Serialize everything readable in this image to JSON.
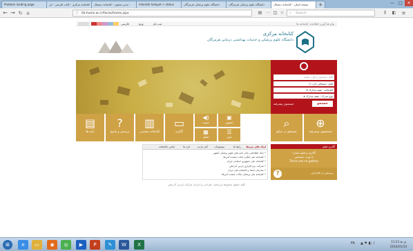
{
  "browser": {
    "tabs": [
      {
        "title": "Problem loading page"
      },
      {
        "title": "کتابخانه مرکزی - کتاب فارسی - ایر"
      },
      {
        "title": "مدیر محتوی - کتابخانه دیجیتال -"
      },
      {
        "title": "mikrotik hotspot > status"
      },
      {
        "title": "دانشگاه علوم پزشکی هرمزگان"
      },
      {
        "title": "دانشگاه علوم پزشکی هرمزگان"
      },
      {
        "title": "صفحه اصلی - کتابخانه دیجیتال"
      }
    ],
    "url": "lib.hums.ac.ir/faces/home.jspx",
    "search_placeholder": "Search",
    "window_controls": [
      "—",
      "□",
      "✕"
    ]
  },
  "site": {
    "topstrip": {
      "left_label": "پیام فنا آوری اطلاعات کتابخانه ها",
      "links": [
        "ثبت نام",
        "ورود",
        "فارسی"
      ]
    },
    "logo": {
      "line1": "کتابخانه مرکزی",
      "line2": "دانشگاه علوم پزشکی و خدمات بهداشتی درمانی هرمزگان"
    },
    "search_panel": {
      "input_placeholder": "کلید جستجو را وارد نمایید",
      "checkbox_label": "فایل دیجیتالی دارد",
      "select1": "همه مدارک",
      "select2": "همه مدارک",
      "select1_label": "کتابخانه",
      "select2_label": "نوع مدرک",
      "advanced_link": "جستجوی پیشرفته",
      "search_button": "جستجو"
    },
    "tiles": [
      {
        "label": "تازه ها",
        "icon": "doc-icon"
      },
      {
        "label": "پرسش و پاسخ",
        "icon": "question-icon"
      },
      {
        "label": "کتابخانه شخصی",
        "icon": "books-icon"
      },
      {
        "label": "گالری",
        "icon": "gallery-icon"
      },
      {
        "label": "صوت",
        "icon": "audio-icon"
      },
      {
        "label": "تصویر",
        "icon": "image-icon"
      },
      {
        "label": "فیلم",
        "icon": "film-icon"
      },
      {
        "label": "متن",
        "icon": "text-icon"
      },
      {
        "label": "جستجو در منابع",
        "icon": "search-icon"
      },
      {
        "label": "جستجوی پیشرفته",
        "icon": "search-plus-icon"
      }
    ],
    "gallery_panel": {
      "title": "گالری فیلم",
      "lines": [
        "گالری و فیلم اشاره",
        "تا نوبت مشخص",
        "There are no gallery"
      ],
      "footer": "پرسش در کتابداری"
    },
    "news": {
      "tabs": [
        "لینک های مرتبط",
        "رابط ها",
        "موضوعات",
        "آمار بازدید",
        "تازه ها",
        "تماس باکتابخانه"
      ],
      "items": [
        "بانک اطلاعاتی پایان نامه های علوم پزشکی کشور",
        "کتابخانه ملی کنگره ایالات متحده آمریکا",
        "کتابخانه ملی جمهوری اسلامی ایران",
        "شرکت نرم افزاری پارس آذرخش",
        "سازمان اسناد و کتابخانه ملی ایران",
        "کتابخانه ملی پزشکی ایالات متحده آمریکا"
      ]
    },
    "footer": "کلیه حقوق محفوظ می‌باشد. طراحی و اجرای شرکت پارس آذرخش"
  },
  "colors": {
    "accent_red": "#b3141b",
    "tile_gold": "#cfa246",
    "logo_teal": "#1b6f86",
    "arrow_red": "#e11b22"
  },
  "taskbar": {
    "apps": [
      "start-icon",
      "ie-icon",
      "explorer-icon",
      "firefox-icon",
      "chrome-icon",
      "media-player-icon",
      "powerpoint-icon",
      "paint-icon",
      "word-icon",
      "excel-icon"
    ],
    "tray": {
      "lang": "FA",
      "time": "11:23 ق.ظ",
      "date": "2016/01/14"
    }
  }
}
